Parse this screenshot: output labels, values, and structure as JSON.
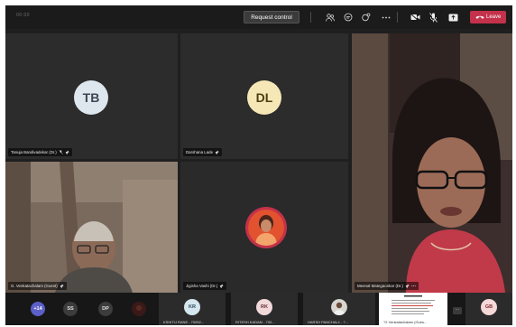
{
  "topbar": {
    "timer": "00:00",
    "request_control_label": "Request control",
    "leave_label": "Leave",
    "icons": [
      "participants-icon",
      "chat-icon",
      "reactions-icon",
      "more-icon",
      "camera-off-icon",
      "mic-off-icon",
      "share-icon",
      "leave-phone-icon"
    ]
  },
  "tiles": [
    {
      "initials": "TB",
      "name": "Tanuja Bandivadekar (Dr.)",
      "avatar_bg": "#dfe7ee",
      "avatar_fg": "#3b4754"
    },
    {
      "initials": "DL",
      "name": "Darshana Lade",
      "avatar_bg": "#f6e8b6",
      "avatar_fg": "#4d3f12"
    },
    {
      "name": "Meenal Mategaonkar (Dr.)"
    },
    {
      "name": "G. Venkatachalam (Guest)"
    },
    {
      "name": "Jigisha Vashi (Dr.)"
    }
  ],
  "strip": {
    "overflow_count": "+14",
    "chips": [
      {
        "initials": "SS",
        "bg": "#3c3c3c",
        "fg": "#e0e0e0"
      },
      {
        "initials": "DP",
        "bg": "#3c3c3c",
        "fg": "#e0e0e0"
      }
    ],
    "thumbs": [
      {
        "initials": "KR",
        "name": "KSHITIJ RANE - 70052...",
        "bg": "#d6e6ee",
        "fg": "#2c4a5a"
      },
      {
        "initials": "RK",
        "name": "RITESH KADAM - 700...",
        "bg": "#f1d9da",
        "fg": "#6a2e33"
      },
      {
        "name": "HARSH PANCHAL1 - 7..."
      },
      {
        "name": "\"G Venkatachalam (Gues..."
      },
      {
        "initials": "GB",
        "bg": "#f7d8d8",
        "fg": "#7a2b2b"
      }
    ],
    "more_label": "..."
  }
}
